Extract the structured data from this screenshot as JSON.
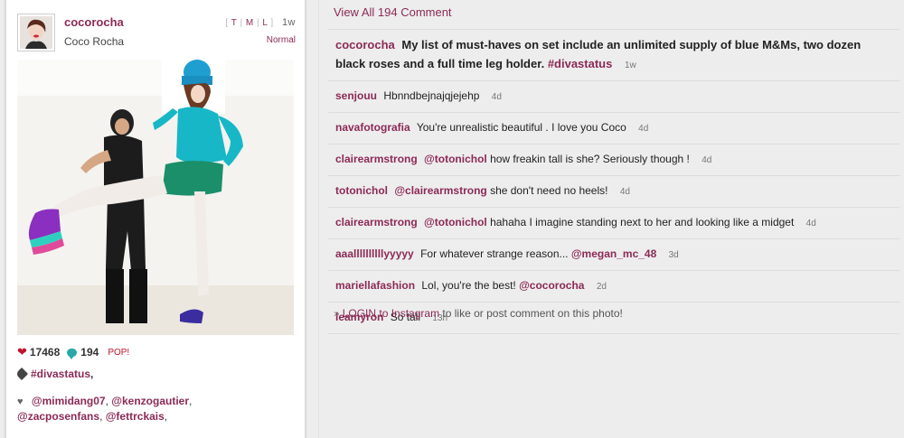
{
  "post": {
    "username": "cocorocha",
    "full_name": "Coco Rocha",
    "view_links": [
      "T",
      "M",
      "L"
    ],
    "time_ago": "1w",
    "filter": "Normal",
    "likes": "17468",
    "comments_count": "194",
    "pop_label": "POP!",
    "tags": [
      "#divastatus"
    ],
    "likers": [
      "@mimidang07",
      "@kenzogautier",
      "@zacposenfans",
      "@fettrckais"
    ]
  },
  "comments_header": "View All 194 Comment",
  "caption": {
    "user": "cocorocha",
    "text": "My list of must-haves on set include an unlimited supply of blue M&Ms, two dozen black roses and a full time leg holder.",
    "hashtag": "#divastatus",
    "time": "1w"
  },
  "comments": [
    {
      "user": "senjouu",
      "pre_mention": "",
      "text": "Hbnndbejnajqjejehp",
      "mention": "",
      "time": "4d"
    },
    {
      "user": "navafotografia",
      "pre_mention": "",
      "text": "You're unrealistic beautiful . I love you Coco",
      "mention": "",
      "time": "4d"
    },
    {
      "user": "clairearmstrong",
      "pre_mention": "@totonichol",
      "text": "how freakin tall is she? Seriously though !",
      "mention": "",
      "time": "4d"
    },
    {
      "user": "totonichol",
      "pre_mention": "@clairearmstrong",
      "text": "she don't need no heels!",
      "mention": "",
      "time": "4d"
    },
    {
      "user": "clairearmstrong",
      "pre_mention": "@totonichol",
      "text": "hahaha I imagine standing next to her and looking like a midget",
      "mention": "",
      "time": "4d"
    },
    {
      "user": "aaallllllllllyyyyy",
      "pre_mention": "",
      "text": "For whatever strange reason...",
      "mention": "@megan_mc_48",
      "time": "3d"
    },
    {
      "user": "mariellafashion",
      "pre_mention": "",
      "text": "Lol, you're the best!",
      "mention": "@cocorocha",
      "time": "2d"
    },
    {
      "user": "leamyron",
      "pre_mention": "",
      "text": "So tall",
      "mention": "",
      "time": "13h"
    }
  ],
  "login": {
    "arrow": "»",
    "link": "LOGIN to Instagram",
    "rest": "to like or post comment on this photo!"
  },
  "icons": {
    "heart": "heart-icon",
    "comment": "comment-bubble-icon",
    "tag": "tag-icon",
    "small_heart": "small-heart-icon"
  },
  "colors": {
    "accent": "#8c2a56",
    "heart": "#c0132b",
    "bubble": "#2aa7a7",
    "background": "#ededed"
  }
}
